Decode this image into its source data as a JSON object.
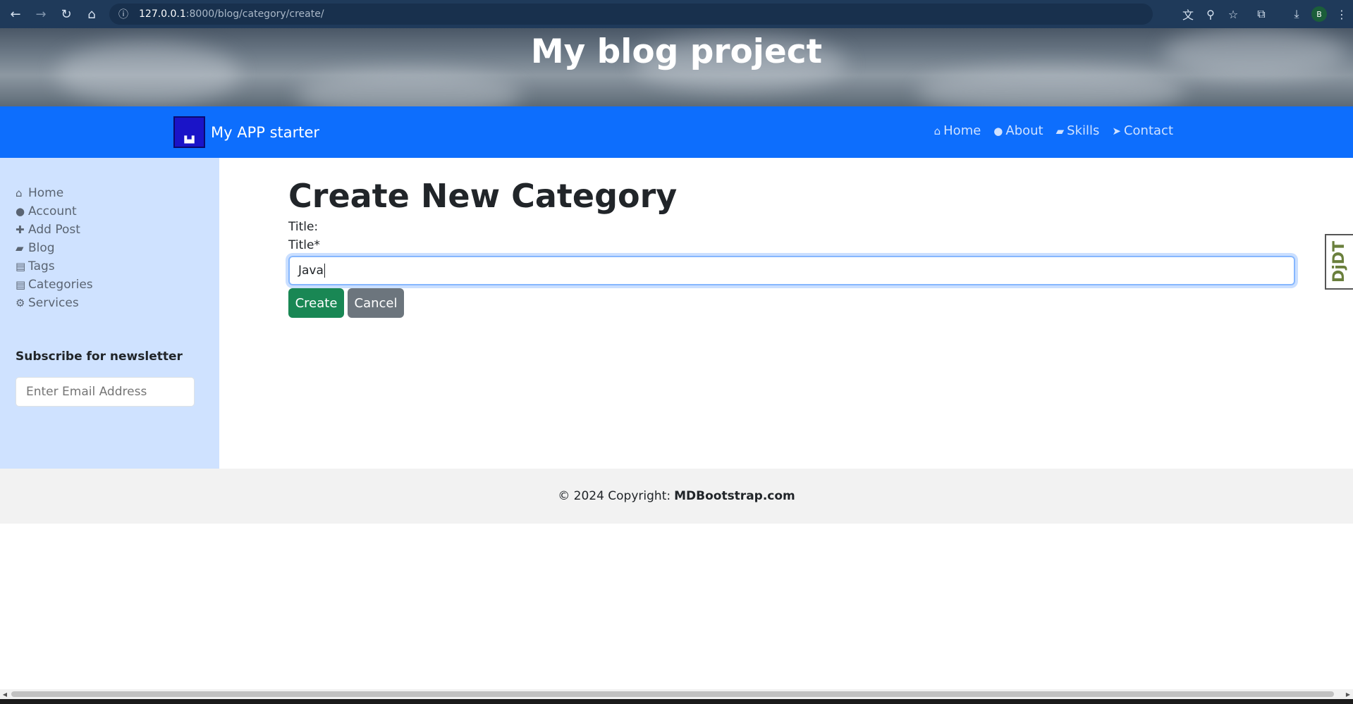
{
  "browser": {
    "url_host": "127.0.0.1",
    "url_path": ":8000/blog/category/create/",
    "profile_initial": "B"
  },
  "banner": {
    "title": "My blog project"
  },
  "navbar": {
    "brand": "My APP starter",
    "items": [
      {
        "label": "Home",
        "icon": "home-icon"
      },
      {
        "label": "About",
        "icon": "user-icon"
      },
      {
        "label": "Skills",
        "icon": "book-icon"
      },
      {
        "label": "Contact",
        "icon": "paper-plane-icon"
      }
    ]
  },
  "sidebar": {
    "items": [
      {
        "label": "Home",
        "icon": "home-icon"
      },
      {
        "label": "Account",
        "icon": "user-icon"
      },
      {
        "label": "Add Post",
        "icon": "plus-icon"
      },
      {
        "label": "Blog",
        "icon": "book-icon"
      },
      {
        "label": "Tags",
        "icon": "briefcase-icon"
      },
      {
        "label": "Categories",
        "icon": "briefcase-icon"
      },
      {
        "label": "Services",
        "icon": "gears-icon"
      }
    ],
    "newsletter_title": "Subscribe for newsletter",
    "newsletter_placeholder": "Enter Email Address"
  },
  "main": {
    "page_title": "Create New Category",
    "title_label_1": "Title:",
    "title_label_2": "Title*",
    "title_value": "Java",
    "create_label": "Create",
    "cancel_label": "Cancel"
  },
  "djdt": {
    "label": "DjDT"
  },
  "footer": {
    "text": "© 2024 Copyright:",
    "link": "MDBootstrap.com"
  }
}
